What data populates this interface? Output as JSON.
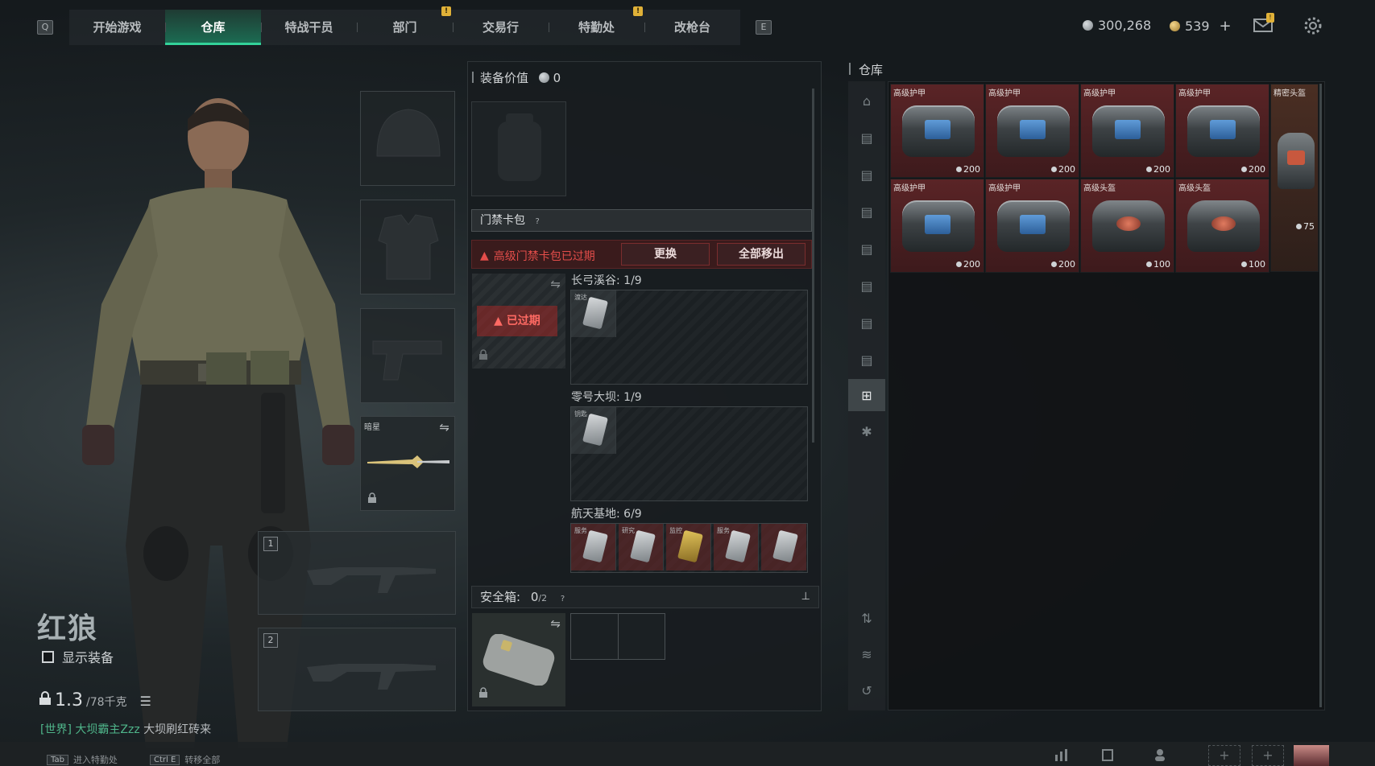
{
  "topbar": {
    "left_key": "Q",
    "right_key": "E",
    "tabs": [
      {
        "label": "开始游戏",
        "active": false,
        "notif": false
      },
      {
        "label": "仓库",
        "active": true,
        "notif": false
      },
      {
        "label": "特战干员",
        "active": false,
        "notif": false
      },
      {
        "label": "部门",
        "active": false,
        "notif": true
      },
      {
        "label": "交易行",
        "active": false,
        "notif": false
      },
      {
        "label": "特勤处",
        "active": false,
        "notif": true
      },
      {
        "label": "改枪台",
        "active": false,
        "notif": false
      }
    ],
    "silver": "300,268",
    "gold": "539",
    "gold_add": "+"
  },
  "character": {
    "name": "红狼",
    "show_equipment": "显示装备",
    "weight_value": "1.3",
    "weight_max": "/78千克",
    "chat_channel": "[世界]",
    "chat_user": "大坝霸主Zzz",
    "chat_msg": "大坝刷红砖来"
  },
  "equipment": {
    "melee_tag": "暗星",
    "weapon_slot_1": "1",
    "weapon_slot_2": "2"
  },
  "middle": {
    "equip_value_label": "装备价值",
    "equip_value": "0",
    "keycard_label": "门禁卡包",
    "help": "?",
    "expired_text": "高级门禁卡包已过期",
    "replace_btn": "更换",
    "remove_all_btn": "全部移出",
    "expired_badge": "已过期",
    "maps": [
      {
        "label": "长弓溪谷: 1/9"
      },
      {
        "label": "零号大坝: 1/9"
      },
      {
        "label": "航天基地: 6/9"
      }
    ],
    "safe_label": "安全箱:",
    "safe_count": "0",
    "safe_max": "/2",
    "card_tags": [
      "渡达",
      "钥匙",
      "服务",
      "研究",
      "监控",
      "服务"
    ]
  },
  "warehouse": {
    "title": "仓库",
    "items": [
      {
        "name": "高级护甲",
        "price": "200",
        "kind": "armor"
      },
      {
        "name": "高级护甲",
        "price": "200",
        "kind": "armor"
      },
      {
        "name": "高级护甲",
        "price": "200",
        "kind": "armor"
      },
      {
        "name": "高级护甲",
        "price": "200",
        "kind": "armor"
      },
      {
        "name": "高级护甲",
        "price": "200",
        "kind": "armor"
      },
      {
        "name": "高级护甲",
        "price": "200",
        "kind": "armor"
      },
      {
        "name": "高级头盔",
        "price": "100",
        "kind": "helmet"
      },
      {
        "name": "高级头盔",
        "price": "100",
        "kind": "helmet"
      }
    ],
    "tall_item": {
      "name": "精密头盔",
      "price": "75"
    }
  },
  "bottom": {
    "hint1_key": "Tab",
    "hint1": "进入特勤处",
    "hint2_key": "Ctrl E",
    "hint2": "转移全部"
  },
  "colors": {
    "accent": "#33d29a",
    "danger": "#e34d4a",
    "item_bg": "#5a2426"
  }
}
